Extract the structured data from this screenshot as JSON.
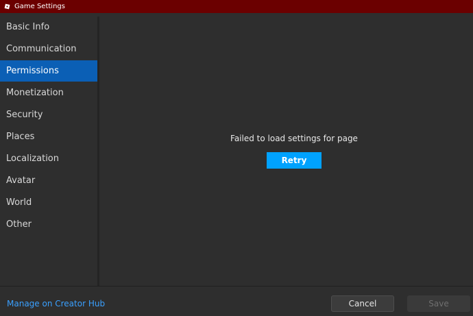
{
  "window": {
    "title": "Game Settings",
    "icon": "roblox-studio-icon",
    "titlebar_color": "#6b0000"
  },
  "sidebar": {
    "items": [
      {
        "label": "Basic Info",
        "selected": false
      },
      {
        "label": "Communication",
        "selected": false
      },
      {
        "label": "Permissions",
        "selected": true
      },
      {
        "label": "Monetization",
        "selected": false
      },
      {
        "label": "Security",
        "selected": false
      },
      {
        "label": "Places",
        "selected": false
      },
      {
        "label": "Localization",
        "selected": false
      },
      {
        "label": "Avatar",
        "selected": false
      },
      {
        "label": "World",
        "selected": false
      },
      {
        "label": "Other",
        "selected": false
      }
    ],
    "selected_color": "#0b5fb5"
  },
  "content": {
    "error_message": "Failed to load settings for page",
    "retry_label": "Retry",
    "retry_color": "#00a2ff"
  },
  "footer": {
    "creator_hub_link": "Manage on Creator Hub",
    "cancel_label": "Cancel",
    "save_label": "Save",
    "save_enabled": false
  }
}
